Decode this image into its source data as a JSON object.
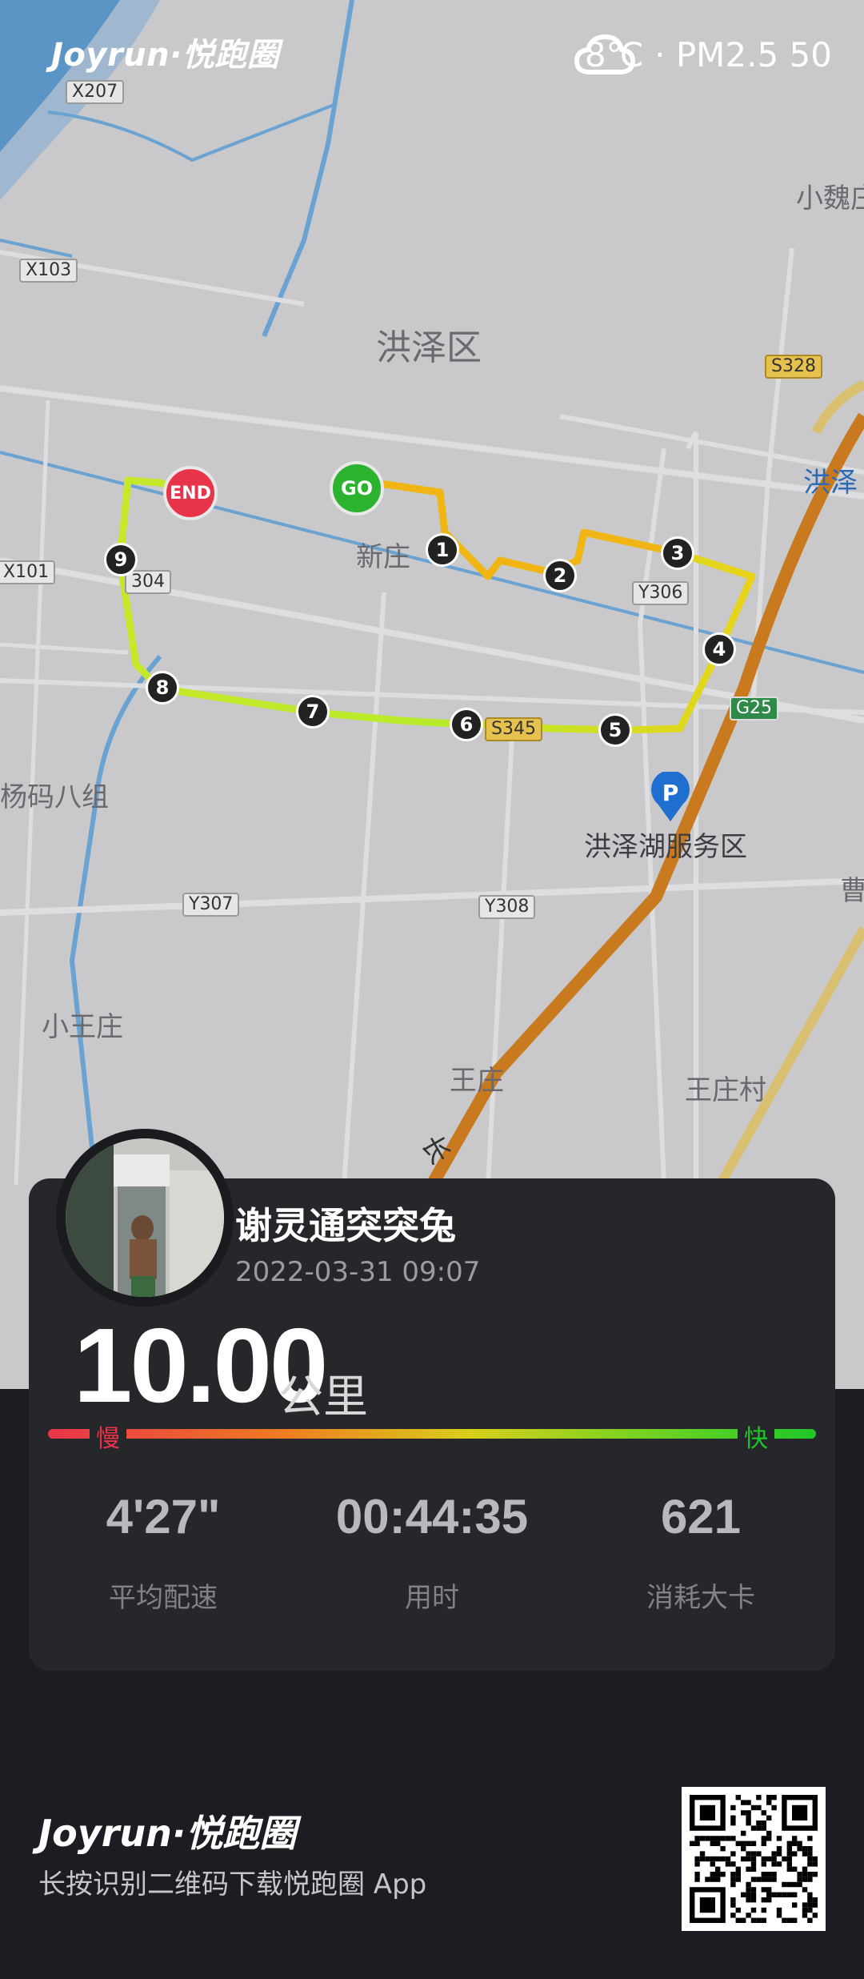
{
  "brand": {
    "logo_text": "Joyrun·悦跑圈"
  },
  "weather": {
    "icon": "cloud-icon",
    "text": "8℃ · PM2.5 50"
  },
  "map": {
    "place_labels": [
      "洪泽区",
      "新庄",
      "小魏庄",
      "洪泽",
      "杨码八组",
      "洪泽湖服务区",
      "小王庄",
      "王庄",
      "王庄村",
      "曹",
      "长"
    ],
    "road_tags": [
      "X207",
      "X103",
      "X101",
      "304",
      "Y306",
      "S328",
      "G25",
      "Y307",
      "Y308",
      "S345"
    ],
    "start_label": "GO",
    "end_label": "END",
    "km_markers": [
      "1",
      "2",
      "3",
      "4",
      "5",
      "6",
      "7",
      "8",
      "9"
    ],
    "parking_icon": "parking-icon"
  },
  "profile": {
    "username": "谢灵通突突兔",
    "datetime": "2022-03-31 09:07"
  },
  "summary": {
    "distance": "10.00",
    "unit": "公里",
    "slow_label": "慢",
    "fast_label": "快"
  },
  "stats": [
    {
      "value": "4'27\"",
      "label": "平均配速"
    },
    {
      "value": "00:44:35",
      "label": "用时"
    },
    {
      "value": "621",
      "label": "消耗大卡"
    }
  ],
  "footer": {
    "logo_text": "Joyrun·悦跑圈",
    "hint": "长按识别二维码下载悦跑圈 App"
  },
  "colors": {
    "slow": "#e8344a",
    "fast": "#1ec828",
    "card": "#25272b",
    "background": "#1c1d23"
  }
}
